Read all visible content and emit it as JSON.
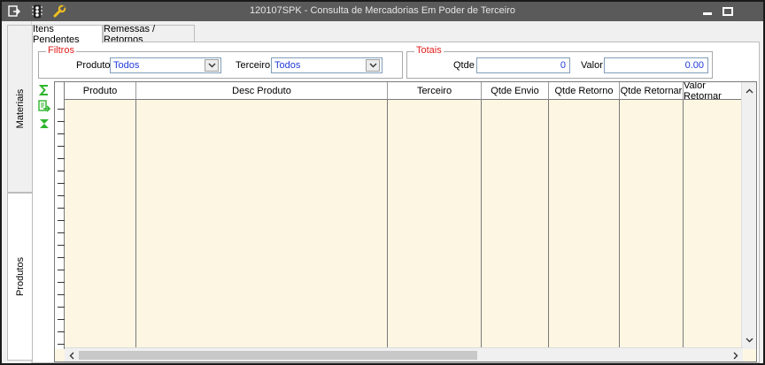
{
  "window": {
    "title": "120107SPK - Consulta de Mercadorias Em Poder de Terceiro"
  },
  "side_tabs": [
    {
      "label": "Materiais"
    },
    {
      "label": "Produtos"
    }
  ],
  "tabs": [
    {
      "label": "Itens Pendentes",
      "active": true
    },
    {
      "label": "Remessas / Retornos",
      "active": false
    }
  ],
  "filtros": {
    "title": "Filtros",
    "produto_label": "Produto",
    "produto_value": "Todos",
    "terceiro_label": "Terceiro",
    "terceiro_value": "Todos"
  },
  "totais": {
    "title": "Totais",
    "qtde_label": "Qtde",
    "qtde_value": "0",
    "valor_label": "Valor",
    "valor_value": "0.00"
  },
  "grid": {
    "columns": [
      {
        "label": "Produto"
      },
      {
        "label": "Desc Produto"
      },
      {
        "label": "Terceiro"
      },
      {
        "label": "Qtde Envio"
      },
      {
        "label": "Qtde Retorno"
      },
      {
        "label": "Qtde Retornar"
      },
      {
        "label": "Valor Retornar"
      }
    ],
    "rows": []
  },
  "icons": {
    "title_bar": [
      "window-menu-icon",
      "traffic-light-icon",
      "wrench-icon"
    ],
    "title_buttons": [
      "minimize-icon",
      "restore-icon"
    ],
    "toolbar": [
      "sum-icon",
      "export-icon",
      "collapse-icon"
    ]
  },
  "colors": {
    "titlebar": "#5a5a5a",
    "group_title": "#e0201e",
    "field_value": "#1f3bd6",
    "grid_background": "#fdf6e3",
    "tool_green": "#2db52d"
  }
}
